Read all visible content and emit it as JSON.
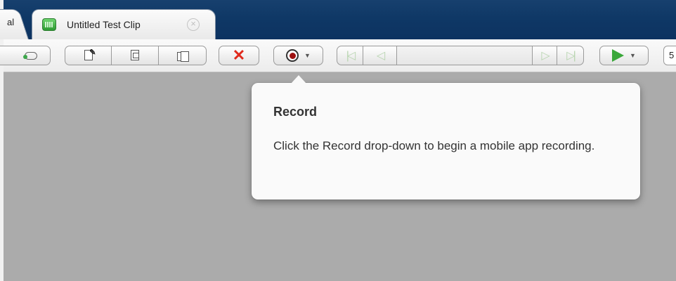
{
  "tabs": {
    "previous_label": "al",
    "active_label": "Untitled Test Clip",
    "close_symbol": "×"
  },
  "toolbar": {
    "buttons": [
      {
        "name": "key-button",
        "icon": "key-icon"
      },
      {
        "name": "edit-step-button",
        "icon": "edit-doc-icon"
      },
      {
        "name": "insert-button",
        "icon": "insert-doc-icon"
      },
      {
        "name": "paste-button",
        "icon": "paste-icon"
      },
      {
        "name": "delete-button",
        "icon": "red-x-icon"
      },
      {
        "name": "record-dropdown",
        "icon": "record-icon"
      },
      {
        "name": "first-step-button",
        "icon": "first-step-icon"
      },
      {
        "name": "previous-step-button",
        "icon": "previous-step-icon"
      },
      {
        "name": "next-step-button",
        "icon": "next-step-icon"
      },
      {
        "name": "last-step-button",
        "icon": "last-step-icon"
      },
      {
        "name": "play-dropdown",
        "icon": "play-icon"
      }
    ],
    "delete_symbol": "✕",
    "caret_symbol": "▼",
    "nav_first": "|◁",
    "nav_prev": "◁",
    "nav_next": "▷",
    "nav_last": "▷|",
    "cut_field_text": "5"
  },
  "tooltip": {
    "title": "Record",
    "body": "Click the Record drop-down to begin a mobile app recording."
  },
  "colors": {
    "tabbar": "#0f3866",
    "background": "#ababab",
    "record_dot": "#9d1010",
    "delete": "#e02a1c",
    "play": "#3aa83a"
  }
}
